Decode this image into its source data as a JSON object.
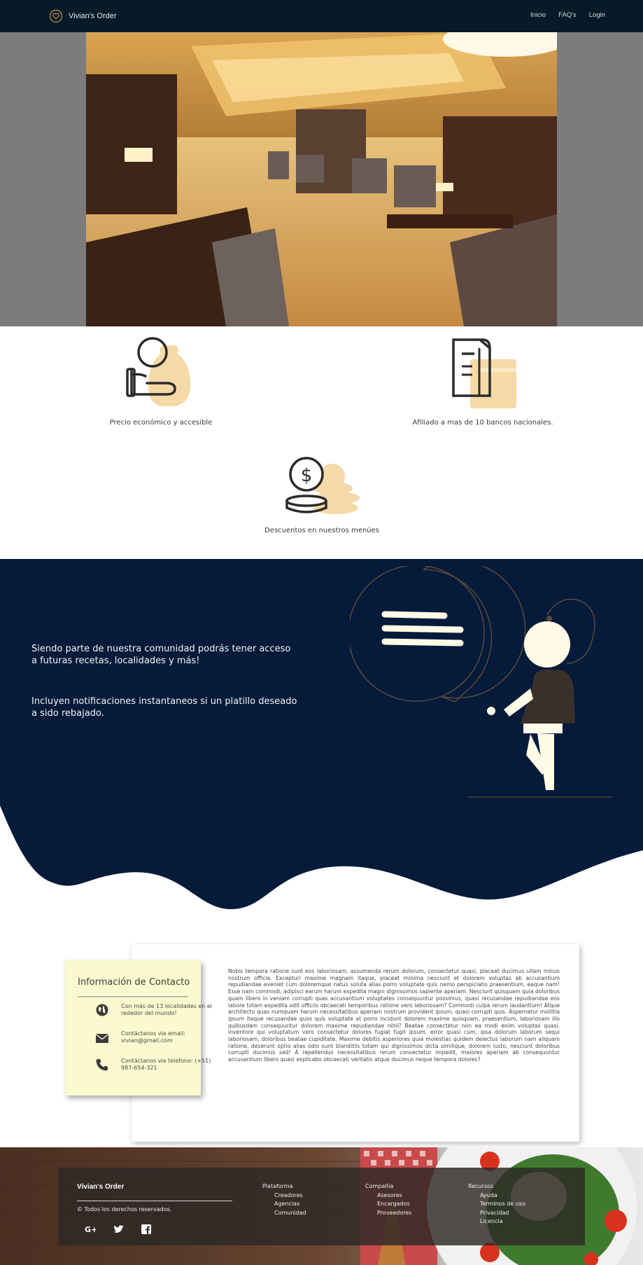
{
  "nav": {
    "brand": "Vivian's Order",
    "links": [
      "Inicio",
      "FAQ's",
      "Login"
    ]
  },
  "features": [
    {
      "label": "Precio económico y accesible"
    },
    {
      "label": "Afiliado a mas de 10 bancos nacionales."
    },
    {
      "label": "Descuentos en nuestros menúes"
    }
  ],
  "promo": {
    "line1": "Siendo parte de nuestra comunidad podrás tener acceso a futuras recetas, localidades y más!",
    "line2": "Incluyen notificaciones instantaneos si un platillo deseado a sido rebajado."
  },
  "contact": {
    "title": "Información de Contacto",
    "items": [
      {
        "icon": "globe-icon",
        "text": "Con más de 13 localidades en el rededor del mundo!"
      },
      {
        "icon": "envelope-icon",
        "text": "Contáctanos via email: vivian@gmail.com"
      },
      {
        "icon": "phone-icon",
        "text": "Contáctanos via telefono: (+51) 987-654-321"
      }
    ],
    "body": "Nobis tempora ratione sunt eos laboriosam, assumenda rerum dolorum, consectetur quasi, placeat ducimus ullam minus nostrum officia. Excepturi maxime magnam itaque, placeat minima nesciunt et dolorem voluptas ab accusantium repudiandae eveniet cum doloremque natus soluta alias porro voluptate quis nemo perspiciatis praesentium, eaque nam! Esse nam commodi, adipisci earum harum expedita magni dignissimos sapiente aperiam. Nesciunt quisquam quia doloribus quam libero in veniam corrupti quas accusantium voluptates consequuntur possimus, quasi recusandae repudiandae eos labore totam expedita odit officiis obcaecati temporibus ratione vero laboriosam? Commodi culpa rerum laudantium! Atque architecto quas numquam harum necessitatibus aperiam nostrum provident ipsum, quasi corrupti quis. Aspernatur mollitia ipsum itaque recusandae quos quis voluptate at porro incidunt dolorem maxime quisquam, praesentium, laboriosam illo quibusdam consequuntur dolorem maxime repudiandae nihil? Beatae consectetur non ea modi enim voluptas quasi. Inventore qui voluptatum vero consectetur dolores fugiat fugit ipsum, error quasi cum, ipsa dolorum laborum sequi laboriosam, doloribus beatae cupiditate. Maxime debitis asperiores quia molestias quidem delectus laborum nam aliquam ratione, deserunt optio alias odio sunt blanditiis totam qui dignissimos dicta similique, dolorem iusto, nesciunt doloribus corrupti ducimus sed! A repellendus necessitatibus rerum consectetur impedit, maiores aperiam ab consequuntur accusantium libero quasi explicabo obcaecati veritatis atque ducimus neque tempora dolores?"
  },
  "footer": {
    "brand": "Vivian's Order",
    "copyright": "© Todos los derechos reservados.",
    "social": [
      "google-plus-icon",
      "twitter-icon",
      "facebook-icon"
    ],
    "columns": [
      {
        "title": "Plataforma",
        "items": [
          "Creadores",
          "Agencias",
          "Comunidad"
        ]
      },
      {
        "title": "Compañía",
        "items": [
          "Asesores",
          "Encargados",
          "Proveedores"
        ]
      },
      {
        "title": "Recursos",
        "items": [
          "Ayuda",
          "Terminos de uso",
          "Privacidad",
          "Licencia"
        ]
      }
    ]
  },
  "colors": {
    "navbar": "#061a28",
    "dark_section": "#061a3a",
    "accent": "#f5d9a6",
    "contact_card": "#fbf9cf"
  }
}
